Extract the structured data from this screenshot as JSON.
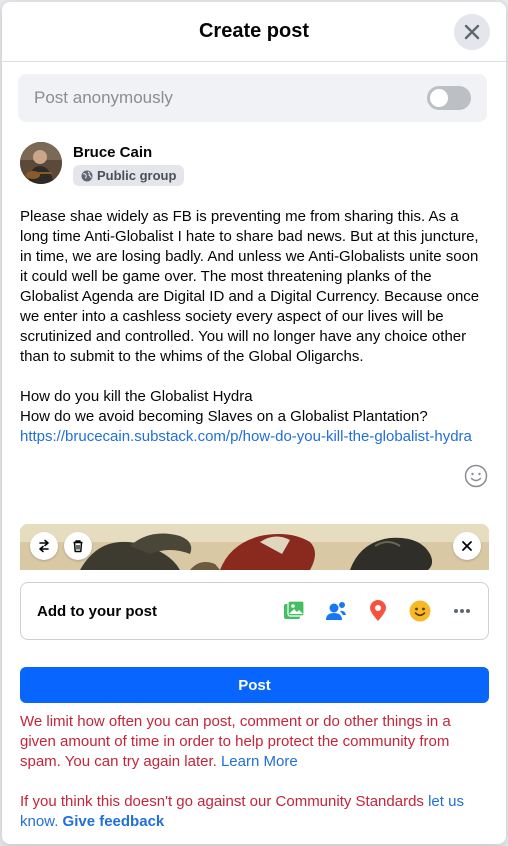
{
  "dialog": {
    "title": "Create post",
    "close_icon": "close-icon"
  },
  "anonymous": {
    "label": "Post anonymously",
    "enabled": false
  },
  "author": {
    "name": "Bruce Cain",
    "audience": "Public group",
    "audience_icon": "globe-icon"
  },
  "post": {
    "paragraph1": "Please shae widely as FB is preventing me from sharing this. As a long time Anti-Globalist I hate to share bad news. But at this juncture, in time, we are losing badly. And unless we Anti-Globalists unite soon it could well be game over. The most threatening planks of the Globalist Agenda are Digital ID and a Digital Currency. Because once we enter into a cashless society every aspect of our lives will be scrutinized and controlled. You will no longer have any choice other than to submit to the whims of the Global Oligarchs.",
    "line2": "How do you kill the Globalist Hydra",
    "line3": "How do we avoid becoming Slaves on a Globalist Plantation?",
    "link": "https://brucecain.substack.com/p/how-do-you-kill-the-globalist-hydra"
  },
  "add_to_post": {
    "label": "Add to your post",
    "icons": [
      "photo-icon",
      "tag-people-icon",
      "location-icon",
      "feeling-icon",
      "more-icon"
    ]
  },
  "post_button": {
    "label": "Post",
    "color": "#0866ff"
  },
  "notice": {
    "limit_text": "We limit how often you can post, comment or do other things in a given amount of time in order to help protect the community from spam. You can try again later.",
    "learn_more": "Learn More",
    "standards_text": "If you think this doesn't go against our Community Standards",
    "let_us_know": "let us know.",
    "give_feedback": "Give feedback",
    "color": "#c4253a"
  }
}
